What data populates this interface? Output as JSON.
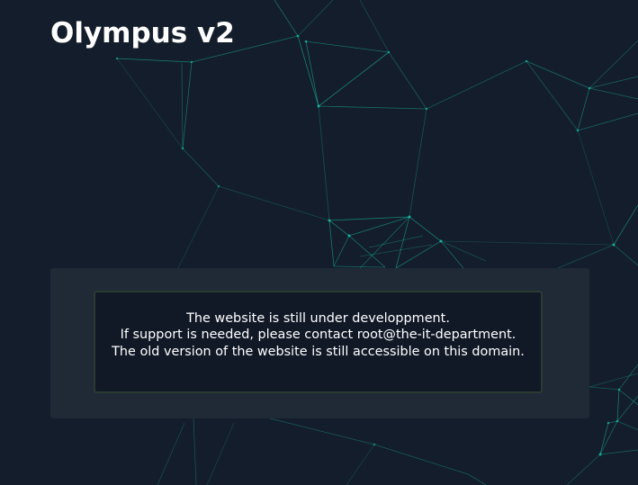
{
  "header": {
    "title": "Olympus v2"
  },
  "notice": {
    "lines": [
      "The website is still under developpment.",
      "If support is needed, please contact root@the-it-department.",
      "The old version of the website is still accessible on this domain."
    ]
  },
  "colors": {
    "background": "#141d2b",
    "panel": "#232c3a",
    "box": "#111927",
    "box_border": "#2a3b31",
    "network_line": "#1bd1b6",
    "title": "#ffffff"
  }
}
